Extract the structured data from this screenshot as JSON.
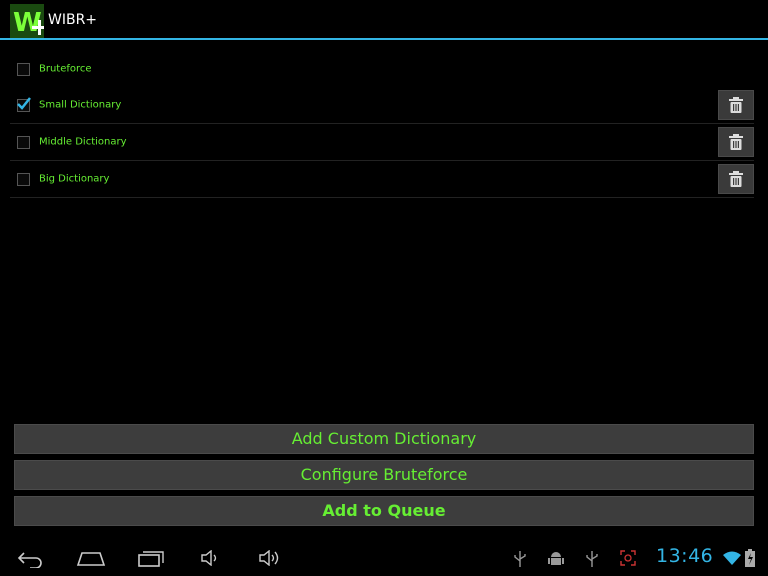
{
  "app": {
    "title": "WIBR+",
    "logo_letter": "W"
  },
  "options": [
    {
      "label": "Bruteforce",
      "checked": false,
      "deletable": false
    },
    {
      "label": "Small Dictionary",
      "checked": true,
      "deletable": true
    },
    {
      "label": "Middle Dictionary",
      "checked": false,
      "deletable": true
    },
    {
      "label": "Big Dictionary",
      "checked": false,
      "deletable": true
    }
  ],
  "buttons": {
    "add_custom": "Add Custom Dictionary",
    "configure": "Configure Bruteforce",
    "queue": "Add to Queue"
  },
  "status": {
    "time": "13:46"
  },
  "colors": {
    "accent": "#33b5e5",
    "label_green": "#66ee33",
    "button_bg": "#3d3d3d"
  },
  "icons": {
    "nav": [
      "back-icon",
      "home-icon",
      "recent-apps-icon",
      "volume-down-icon",
      "volume-up-icon"
    ],
    "status": [
      "usb-icon",
      "android-debug-icon",
      "usb-icon",
      "screenshot-icon",
      "wifi-icon",
      "battery-icon"
    ]
  }
}
